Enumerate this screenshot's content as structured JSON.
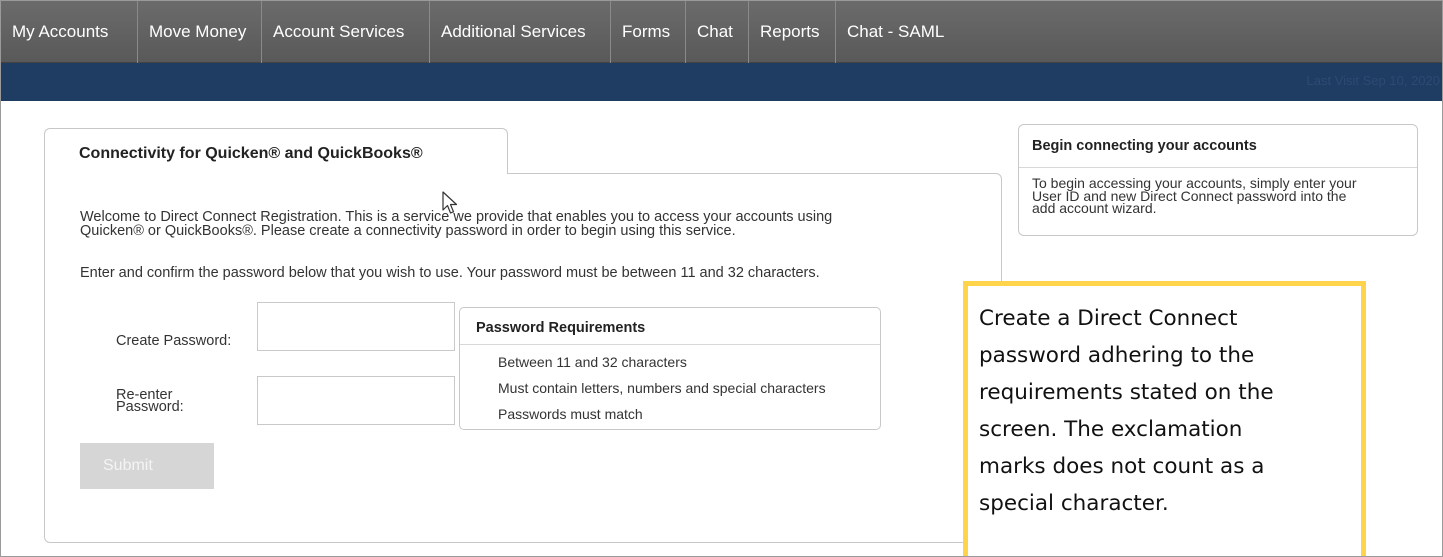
{
  "nav": {
    "items": [
      {
        "label": "My Accounts"
      },
      {
        "label": "Move Money"
      },
      {
        "label": "Account Services"
      },
      {
        "label": "Additional Services"
      },
      {
        "label": "Forms"
      },
      {
        "label": "Chat"
      },
      {
        "label": "Reports"
      },
      {
        "label": "Chat - SAML"
      }
    ],
    "last_visit": "Last Visit Sep 10, 2020"
  },
  "main": {
    "tab_label": "Connectivity for Quicken® and QuickBooks®",
    "intro_line1": "Welcome to Direct Connect Registration. This is a service we provide that enables you to access your accounts using",
    "intro_line2": "Quicken® or QuickBooks®. Please create a connectivity password in order to begin using this service.",
    "instruction": "Enter and confirm the password below that you wish to use. Your password must be between 11 and 32 characters.",
    "create_password_label": "Create Password:",
    "reenter_label_line1": "Re-enter",
    "reenter_label_line2": "Password:",
    "create_password_value": "",
    "reenter_password_value": "",
    "submit_label": "Submit",
    "requirements": {
      "title": "Password Requirements",
      "items": [
        "Between 11 and 32 characters",
        "Must contain letters, numbers and special characters",
        "Passwords must match"
      ]
    }
  },
  "sidebar": {
    "title": "Begin connecting your accounts",
    "text_line1": "To begin accessing your accounts, simply enter your",
    "text_line2": "User ID and new Direct Connect password into the",
    "text_line3": "add account wizard."
  },
  "callout": {
    "line1": "Create a Direct Connect",
    "line2": "password adhering to the",
    "line3": "requirements stated on the",
    "line4": "screen. The exclamation",
    "line5": "marks does not count as a",
    "line6": "special character.",
    "border_color": "#ffd44a"
  },
  "colors": {
    "nav_bg": "#5f5f5f",
    "subbar_bg": "#1f3d63",
    "submit_disabled": "#d6d6d6"
  },
  "icons": {
    "cursor": "mouse-pointer-icon"
  }
}
